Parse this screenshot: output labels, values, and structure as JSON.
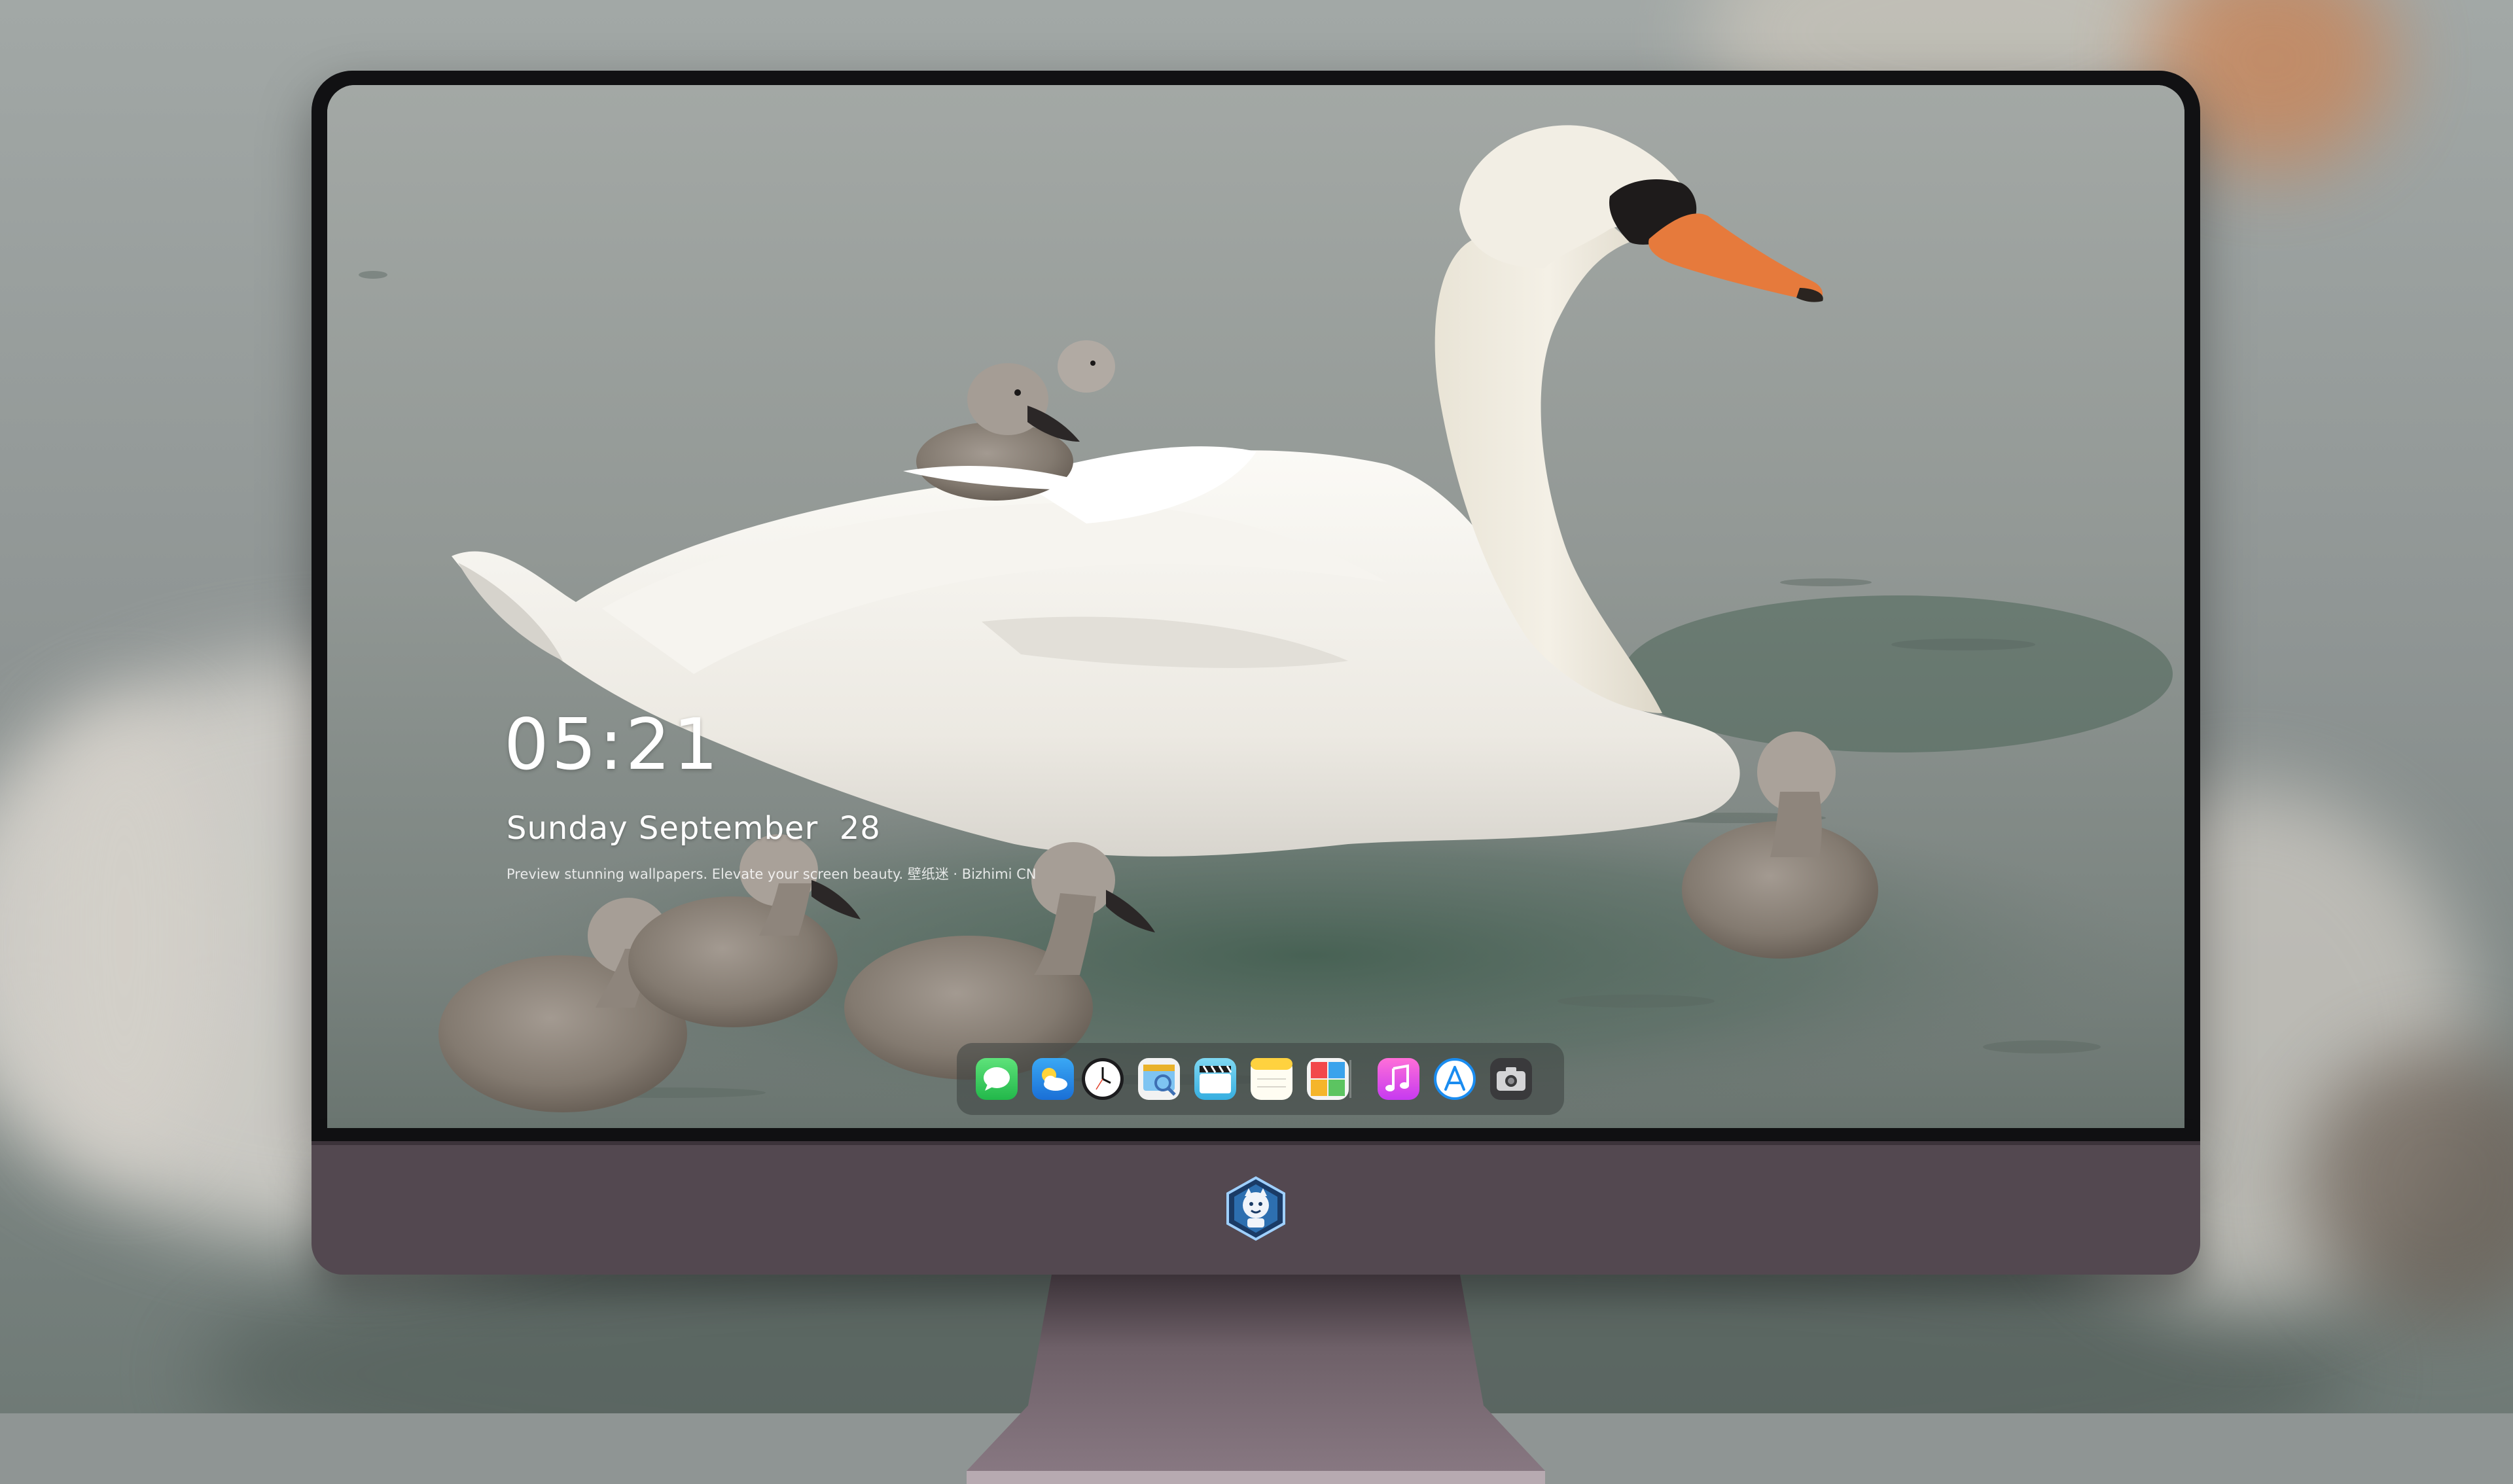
{
  "lock_screen": {
    "time": "05:21",
    "date": "Sunday September  28",
    "tagline": "Preview stunning wallpapers. Elevate your screen beauty. 壁纸迷 · Bizhimi CN"
  },
  "dock": {
    "apps": [
      {
        "name": "Messages",
        "icon": "messages-icon"
      },
      {
        "name": "Weather",
        "icon": "weather-icon"
      },
      {
        "name": "Clock",
        "icon": "clock-icon"
      },
      {
        "name": "Preview",
        "icon": "preview-icon"
      },
      {
        "name": "Clips",
        "icon": "clips-icon"
      },
      {
        "name": "Notes",
        "icon": "notes-icon"
      },
      {
        "name": "Photo Booth",
        "icon": "photo-booth-icon"
      },
      {
        "name": "Music",
        "icon": "music-icon"
      },
      {
        "name": "App Store",
        "icon": "app-store-icon"
      },
      {
        "name": "Camera",
        "icon": "camera-icon"
      }
    ]
  },
  "colors": {
    "chin": "#534850",
    "bezel": "#111113",
    "messages": "#34c759",
    "weather": "#2f9bf0",
    "music": "#f05ad8",
    "app_store": "#1a8cf0"
  }
}
